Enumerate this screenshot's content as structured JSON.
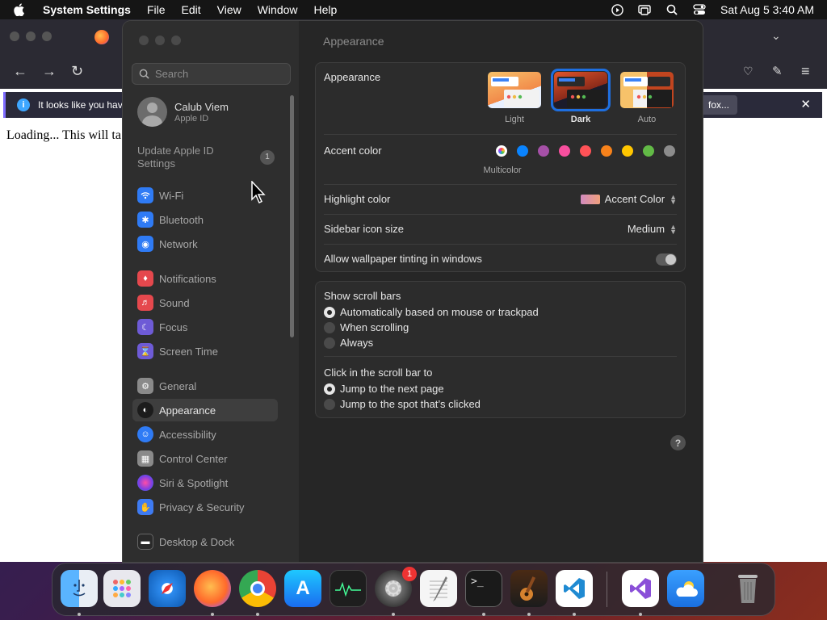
{
  "menubar": {
    "app_name": "System Settings",
    "menus": [
      "File",
      "Edit",
      "View",
      "Window",
      "Help"
    ],
    "datetime": "Sat Aug 5  3:40 AM"
  },
  "browser": {
    "info_text": "It looks like you have",
    "info_button": "fox...",
    "content_text": "Loading... This will ta"
  },
  "sidebar": {
    "search_placeholder": "Search",
    "user_name": "Calub Viem",
    "user_sub": "Apple ID",
    "update_text": "Update Apple ID Settings",
    "update_badge": "1",
    "items": [
      {
        "label": "Wi-Fi",
        "icon": "wifi-icon",
        "color": "#2f7bf5"
      },
      {
        "label": "Bluetooth",
        "icon": "bluetooth-icon",
        "color": "#2f7bf5"
      },
      {
        "label": "Network",
        "icon": "network-icon",
        "color": "#2f7bf5"
      },
      {
        "label": "Notifications",
        "icon": "notifications-icon",
        "color": "#e5484d"
      },
      {
        "label": "Sound",
        "icon": "sound-icon",
        "color": "#e5484d"
      },
      {
        "label": "Focus",
        "icon": "focus-icon",
        "color": "#6e5bd6"
      },
      {
        "label": "Screen Time",
        "icon": "screen-time-icon",
        "color": "#6e5bd6"
      },
      {
        "label": "General",
        "icon": "general-icon",
        "color": "#8a8a8a"
      },
      {
        "label": "Appearance",
        "icon": "appearance-icon",
        "color": "#1c1c1c"
      },
      {
        "label": "Accessibility",
        "icon": "accessibility-icon",
        "color": "#2f7bf5"
      },
      {
        "label": "Control Center",
        "icon": "control-center-icon",
        "color": "#8a8a8a"
      },
      {
        "label": "Siri & Spotlight",
        "icon": "siri-icon",
        "color": "#a54bd6"
      },
      {
        "label": "Privacy & Security",
        "icon": "privacy-icon",
        "color": "#3e7bf2"
      },
      {
        "label": "Desktop & Dock",
        "icon": "desktop-dock-icon",
        "color": "#2a2a2a"
      }
    ]
  },
  "main": {
    "title": "Appearance",
    "appearance_label": "Appearance",
    "appearance_options": [
      "Light",
      "Dark",
      "Auto"
    ],
    "appearance_selected": "Dark",
    "accent_label": "Accent color",
    "accent_selected": "Multicolor",
    "accent_colors": [
      "#0a84ff",
      "#a550a7",
      "#f74f9e",
      "#ff5257",
      "#f7821b",
      "#ffc600",
      "#62ba46",
      "#8c8c8c"
    ],
    "highlight_label": "Highlight color",
    "highlight_value": "Accent Color",
    "icon_size_label": "Sidebar icon size",
    "icon_size_value": "Medium",
    "tinting_label": "Allow wallpaper tinting in windows",
    "scroll_label": "Show scroll bars",
    "scroll_options": [
      "Automatically based on mouse or trackpad",
      "When scrolling",
      "Always"
    ],
    "click_label": "Click in the scroll bar to",
    "click_options": [
      "Jump to the next page",
      "Jump to the spot that’s clicked"
    ],
    "help": "?"
  },
  "dock": {
    "apps": [
      "Finder",
      "Launchpad",
      "Safari",
      "Firefox",
      "Chrome",
      "App Store",
      "Activity Monitor",
      "System Settings",
      "TextEdit",
      "Terminal",
      "GarageBand",
      "VS Code",
      "Visual Studio",
      "Weather",
      "Trash"
    ],
    "settings_badge": "1"
  }
}
